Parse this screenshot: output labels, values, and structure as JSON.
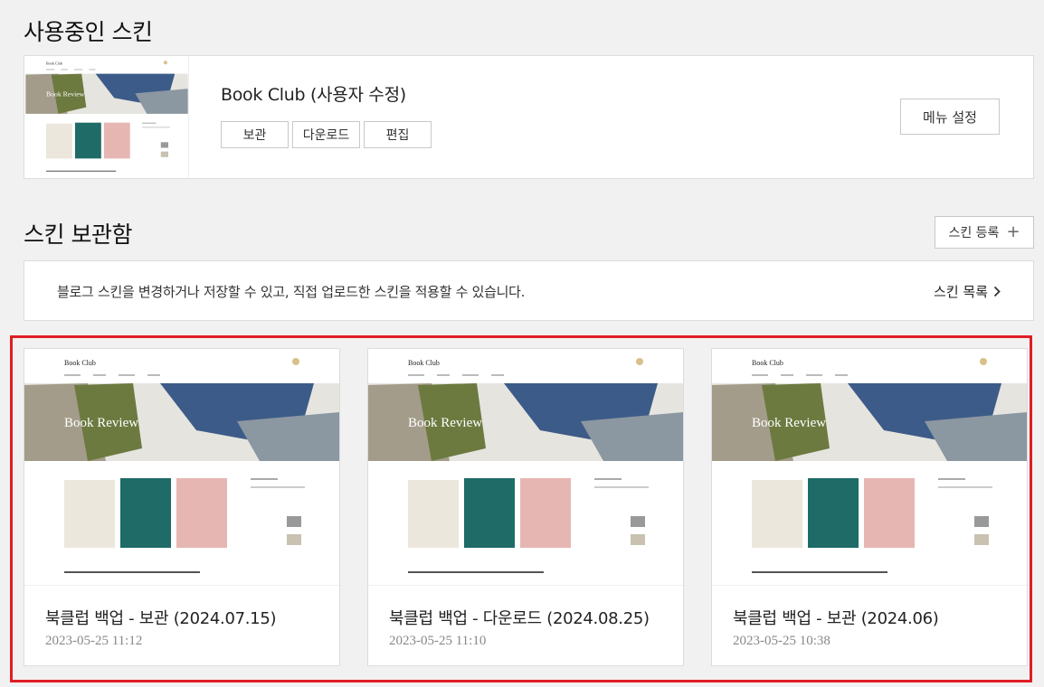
{
  "current": {
    "section_title": "사용중인 스킨",
    "skin_name": "Book Club (사용자 수정)",
    "actions": [
      "보관",
      "다운로드",
      "편집"
    ],
    "menu_settings": "메뉴 설정"
  },
  "storage": {
    "section_title": "스킨 보관함",
    "register_button": "스킨 등록",
    "info_text": "블로그 스킨을 변경하거나 저장할 수 있고, 직접 업로드한 스킨을 적용할 수 있습니다.",
    "list_link": "스킨 목록",
    "items": [
      {
        "name": "북클럽 백업 - 보관 (2024.07.15)",
        "date": "2023-05-25 11:12"
      },
      {
        "name": "북클럽 백업 - 다운로드 (2024.08.25)",
        "date": "2023-05-25 11:10"
      },
      {
        "name": "북클럽 백업 - 보관 (2024.06)",
        "date": "2023-05-25 10:38"
      }
    ]
  },
  "thumbnail": {
    "logo": "Book Club",
    "hero_text": "Book Review"
  },
  "colors": {
    "highlight": "#e01e26",
    "background": "#f1f1f1"
  }
}
